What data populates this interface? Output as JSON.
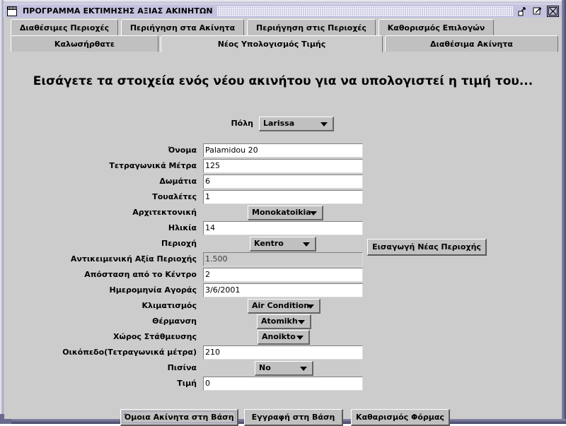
{
  "window": {
    "title": "ΠΡΟΓΡΑΜΜΑ ΕΚΤΙΜΗΣΗΣ ΑΞΙΑΣ ΑΚΙΝΗΤΩΝ",
    "icon": "window-document-icon",
    "controls": [
      {
        "name": "minimize-button",
        "glyph": "minimize-icon"
      },
      {
        "name": "maximize-button",
        "glyph": "maximize-icon"
      },
      {
        "name": "close-button",
        "glyph": "close-icon"
      }
    ]
  },
  "tabs_row1": [
    {
      "label": "Διαθέσιμες Περιοχές",
      "selected": false
    },
    {
      "label": "Περιήγηση στα Ακίνητα",
      "selected": false
    },
    {
      "label": "Περιήγηση στις Περιοχές",
      "selected": false
    },
    {
      "label": "Καθορισμός Επιλογών",
      "selected": false
    }
  ],
  "tabs_row2": [
    {
      "label": "Καλωσήρθατε",
      "selected": false
    },
    {
      "label": "Νέος Υπολογισμός Τιμής",
      "selected": true
    },
    {
      "label": "Διαθέσιμα Ακίνητα",
      "selected": false
    }
  ],
  "heading": "Εισάγετε τα στοιχεία ενός νέου ακινήτου για να υπολογιστεί η τιμή του...",
  "city_row": {
    "label": "Πόλη",
    "value": "Larissa"
  },
  "fields": [
    {
      "label": "Όνομα",
      "type": "text",
      "value": "Palamidou 20",
      "disabled": false
    },
    {
      "label": "Τετραγωνικά Μέτρα",
      "type": "text",
      "value": "125",
      "disabled": false
    },
    {
      "label": "Δωμάτια",
      "type": "text",
      "value": "6",
      "disabled": false
    },
    {
      "label": "Τουαλέτες",
      "type": "text",
      "value": "1",
      "disabled": false
    },
    {
      "label": "Αρχιτεκτονική",
      "type": "combo",
      "value": "Monokatoikia",
      "disabled": false
    },
    {
      "label": "Ηλικία",
      "type": "text",
      "value": "14",
      "disabled": false
    },
    {
      "label": "Περιοχή",
      "type": "combo",
      "value": "Kentro",
      "disabled": false
    },
    {
      "label": "Αντικειμενική Αξία Περιοχής",
      "type": "text",
      "value": "1.500",
      "disabled": true
    },
    {
      "label": "Απόσταση από το Κέντρο",
      "type": "text",
      "value": "2",
      "disabled": false
    },
    {
      "label": "Ημερομηνία Αγοράς",
      "type": "text",
      "value": "3/6/2001",
      "disabled": false
    },
    {
      "label": "Κλιματισμός",
      "type": "combo",
      "value": "Air Condition",
      "disabled": false
    },
    {
      "label": "Θέρμανση",
      "type": "combo",
      "value": "Atomikh",
      "disabled": false
    },
    {
      "label": "Χώρος Στάθμευσης",
      "type": "combo",
      "value": "Anoikto",
      "disabled": false
    },
    {
      "label": "Οικόπεδο(Τετραγωνικά μέτρα)",
      "type": "text",
      "value": "210",
      "disabled": false
    },
    {
      "label": "Πισίνα",
      "type": "combo",
      "value": "No",
      "disabled": false
    },
    {
      "label": "Τιμή",
      "type": "text",
      "value": "0",
      "disabled": false
    }
  ],
  "side_button": {
    "label": "Εισαγωγή Νέας Περιοχής"
  },
  "bottom_buttons": [
    {
      "label": "Όμοια Ακίνητα στη Βάση",
      "focused": true
    },
    {
      "label": "Εγγραφή στη Βάση",
      "focused": false
    },
    {
      "label": "Καθαρισμός Φόρμας",
      "focused": false
    }
  ],
  "colors": {
    "titlebar": "#c3c3e0",
    "client": "#cccccc",
    "control": "#c0c0c0",
    "frame": "#6a6a90"
  }
}
